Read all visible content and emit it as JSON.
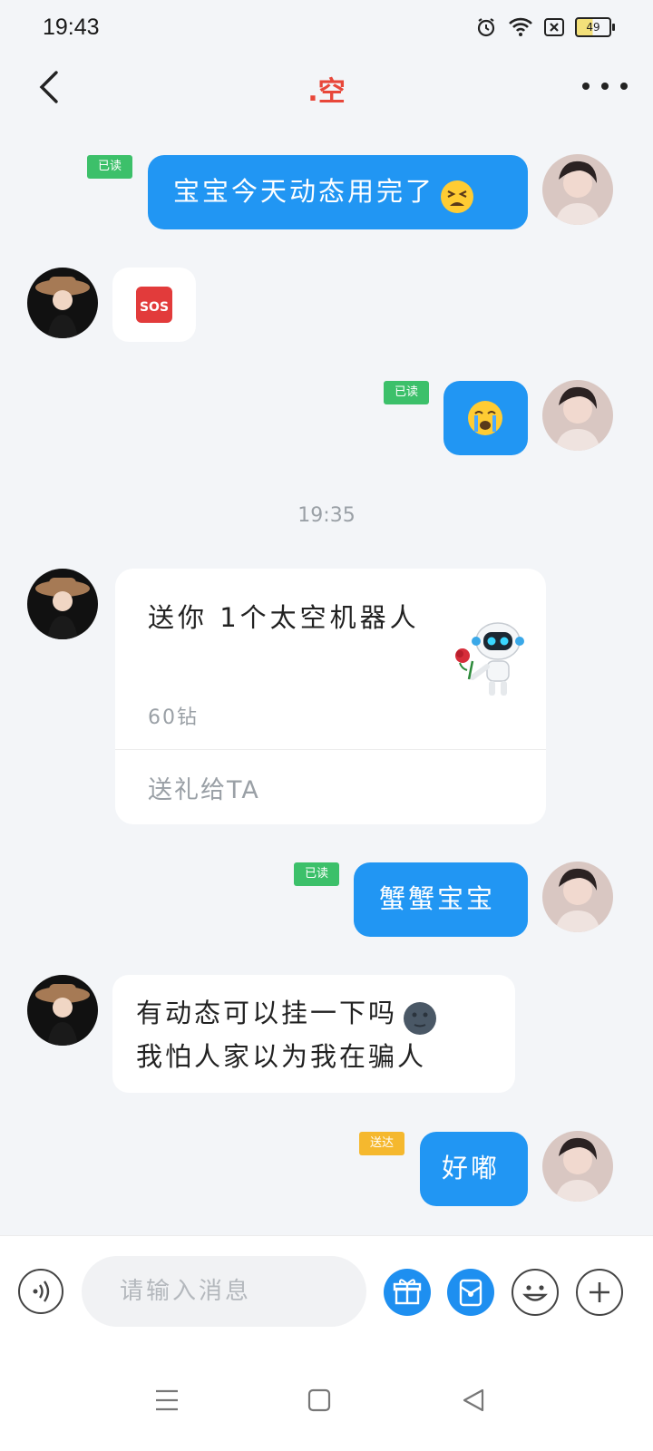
{
  "status_bar": {
    "time": "19:43",
    "battery": "49"
  },
  "header": {
    "title": ".空"
  },
  "messages": {
    "m1": {
      "text": "宝宝今天动态用完了",
      "status": "已读"
    },
    "m2": {
      "text": "🆘"
    },
    "m3": {
      "status": "已读"
    },
    "timestamp": "19:35",
    "gift": {
      "title": "送你 1个太空机器人",
      "price": "60钻",
      "send_label": "送礼给TA"
    },
    "m4": {
      "text": "蟹蟹宝宝",
      "status": "已读"
    },
    "m5": {
      "line1": "有动态可以挂一下吗",
      "line2": "我怕人家以为我在骗人"
    },
    "m6": {
      "text": "好嘟",
      "status": "送达"
    }
  },
  "input": {
    "placeholder": "请输入消息"
  },
  "colors": {
    "accent": "#2196f3",
    "title": "#e8473a",
    "read_badge": "#3cc06a",
    "sent_badge": "#f5b82e"
  }
}
